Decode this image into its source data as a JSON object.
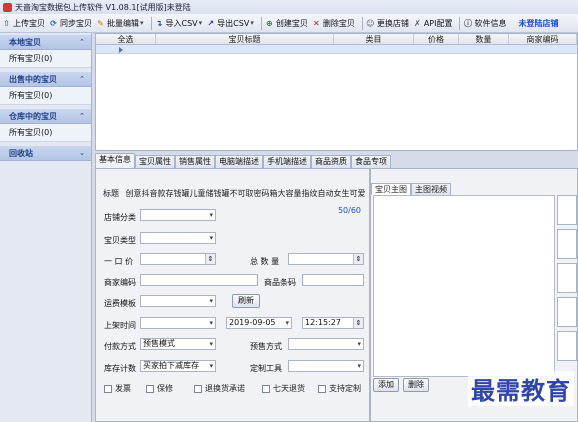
{
  "window": {
    "title": "天啬淘宝数据包上传软件 V1.08.1[试用版]未登陆"
  },
  "toolbar": {
    "items": [
      {
        "label": "上传宝贝",
        "icon": "upload-icon",
        "color": "#2a8a2a"
      },
      {
        "label": "同步宝贝",
        "icon": "sync-icon",
        "color": "#2a5fc4"
      },
      {
        "label": "批量编辑",
        "icon": "pencil-icon",
        "color": "#c47a00"
      },
      {
        "label": "导入CSV",
        "icon": "import-icon",
        "color": "#1b3f8a"
      },
      {
        "label": "导出CSV",
        "icon": "export-icon",
        "color": "#1b3f8a"
      },
      {
        "label": "创建宝贝",
        "icon": "plus-icon",
        "color": "#1e8a2a"
      },
      {
        "label": "删除宝贝",
        "icon": "delete-icon",
        "color": "#c41b1b"
      },
      {
        "label": "更换店铺",
        "icon": "user-icon",
        "color": "#555555"
      },
      {
        "label": "API配置",
        "icon": "wrench-icon",
        "color": "#555555"
      },
      {
        "label": "软件信息",
        "icon": "info-icon",
        "color": "#555555"
      }
    ],
    "login_label": "未登陆店铺"
  },
  "sidebar": {
    "groups": [
      {
        "title": "本地宝贝",
        "items": [
          "所有宝贝(0)"
        ]
      },
      {
        "title": "出售中的宝贝",
        "items": [
          "所有宝贝(0)"
        ]
      },
      {
        "title": "仓库中的宝贝",
        "items": [
          "所有宝贝(0)"
        ]
      },
      {
        "title": "回收站",
        "items": []
      }
    ]
  },
  "grid": {
    "columns": [
      "全选",
      "宝贝标题",
      "类目",
      "价格",
      "数量",
      "商家编码"
    ]
  },
  "tabs": [
    "基本信息",
    "宝贝属性",
    "销售属性",
    "电脑端描述",
    "手机端描述",
    "商品资质",
    "食品专项"
  ],
  "form": {
    "title_label": "标题",
    "title_value": "创意抖音款存钱罐儿童储钱罐不可取密码箱大容量指纹自动女生可爱",
    "title_count": "50/60",
    "shop_category_label": "店铺分类",
    "item_type_label": "宝贝类型",
    "price_label": "一 口 价",
    "total_qty_label": "总 数 量",
    "merchant_code_label": "商家编码",
    "barcode_label": "商品条码",
    "shipping_template_label": "运费模板",
    "refresh_button": "刷新",
    "list_time_label": "上架时间",
    "list_date": "2019-09-05",
    "list_time": "12:15:27",
    "payment_label": "付款方式",
    "payment_value": "预售模式",
    "presale_label": "预售方式",
    "stock_label": "库存计数",
    "stock_value": "买家拍下减库存",
    "custom_tool_label": "定制工具",
    "checkboxes": [
      "发票",
      "保修",
      "退换货承诺",
      "七天退货",
      "支持定制"
    ]
  },
  "right_panel": {
    "tabs": [
      "宝贝主图",
      "主图视频"
    ],
    "buttons": [
      "添加",
      "删除"
    ]
  },
  "watermark": "最需教育"
}
